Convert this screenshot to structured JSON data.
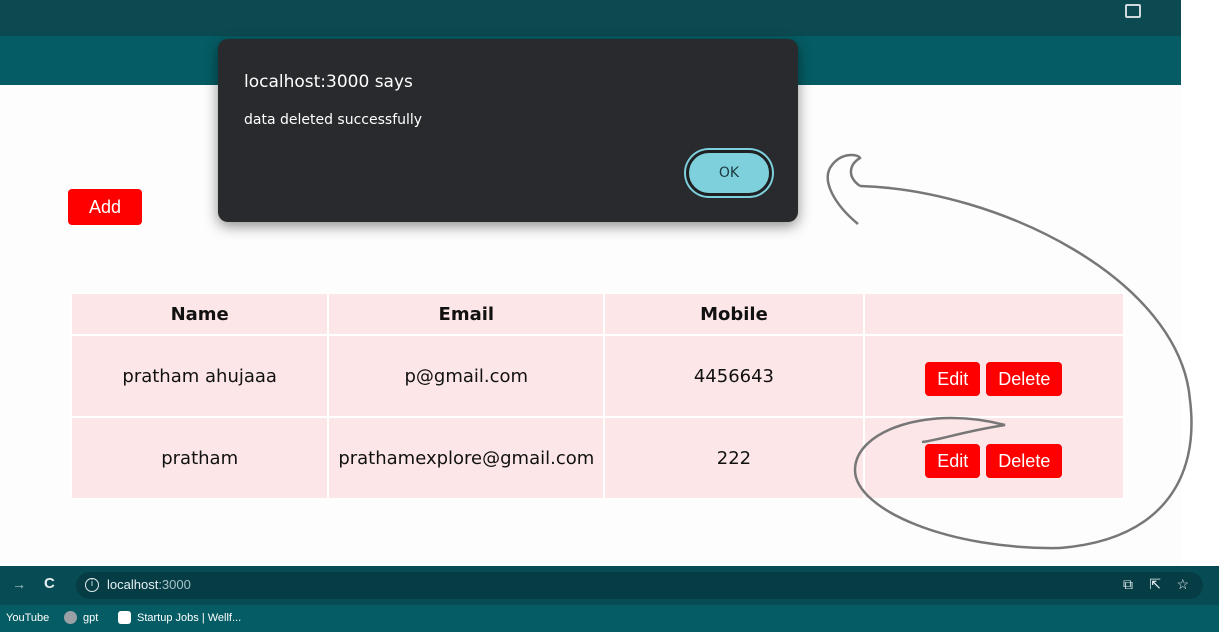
{
  "dialog": {
    "title": "localhost:3000 says",
    "message": "data deleted successfully",
    "ok_label": "OK"
  },
  "toolbar": {
    "add_label": "Add"
  },
  "table": {
    "headers": [
      "Name",
      "Email",
      "Mobile",
      ""
    ],
    "rows": [
      {
        "name": "pratham ahujaaa",
        "email": "p@gmail.com",
        "mobile": "4456643",
        "edit_label": "Edit",
        "delete_label": "Delete"
      },
      {
        "name": "pratham",
        "email": "prathamexplore@gmail.com",
        "mobile": "222",
        "edit_label": "Edit",
        "delete_label": "Delete"
      }
    ]
  },
  "browser": {
    "url_host": "localhost",
    "url_port": ":3000",
    "info_glyph": "i",
    "bookmarks": [
      "YouTube",
      "gpt",
      "Startup Jobs | Wellf..."
    ]
  },
  "colors": {
    "accent_red": "#ff0000",
    "table_bg": "#fde6e7",
    "chrome_teal": "#055c64",
    "dialog_bg": "#292a2d",
    "ok_button": "#7ed1dc"
  },
  "icons": [
    "screen-cast-icon",
    "forward-arrow-icon",
    "reload-icon",
    "site-info-icon",
    "install-app-icon",
    "share-icon",
    "bookmark-star-icon",
    "gpt-icon",
    "wellfound-icon"
  ]
}
